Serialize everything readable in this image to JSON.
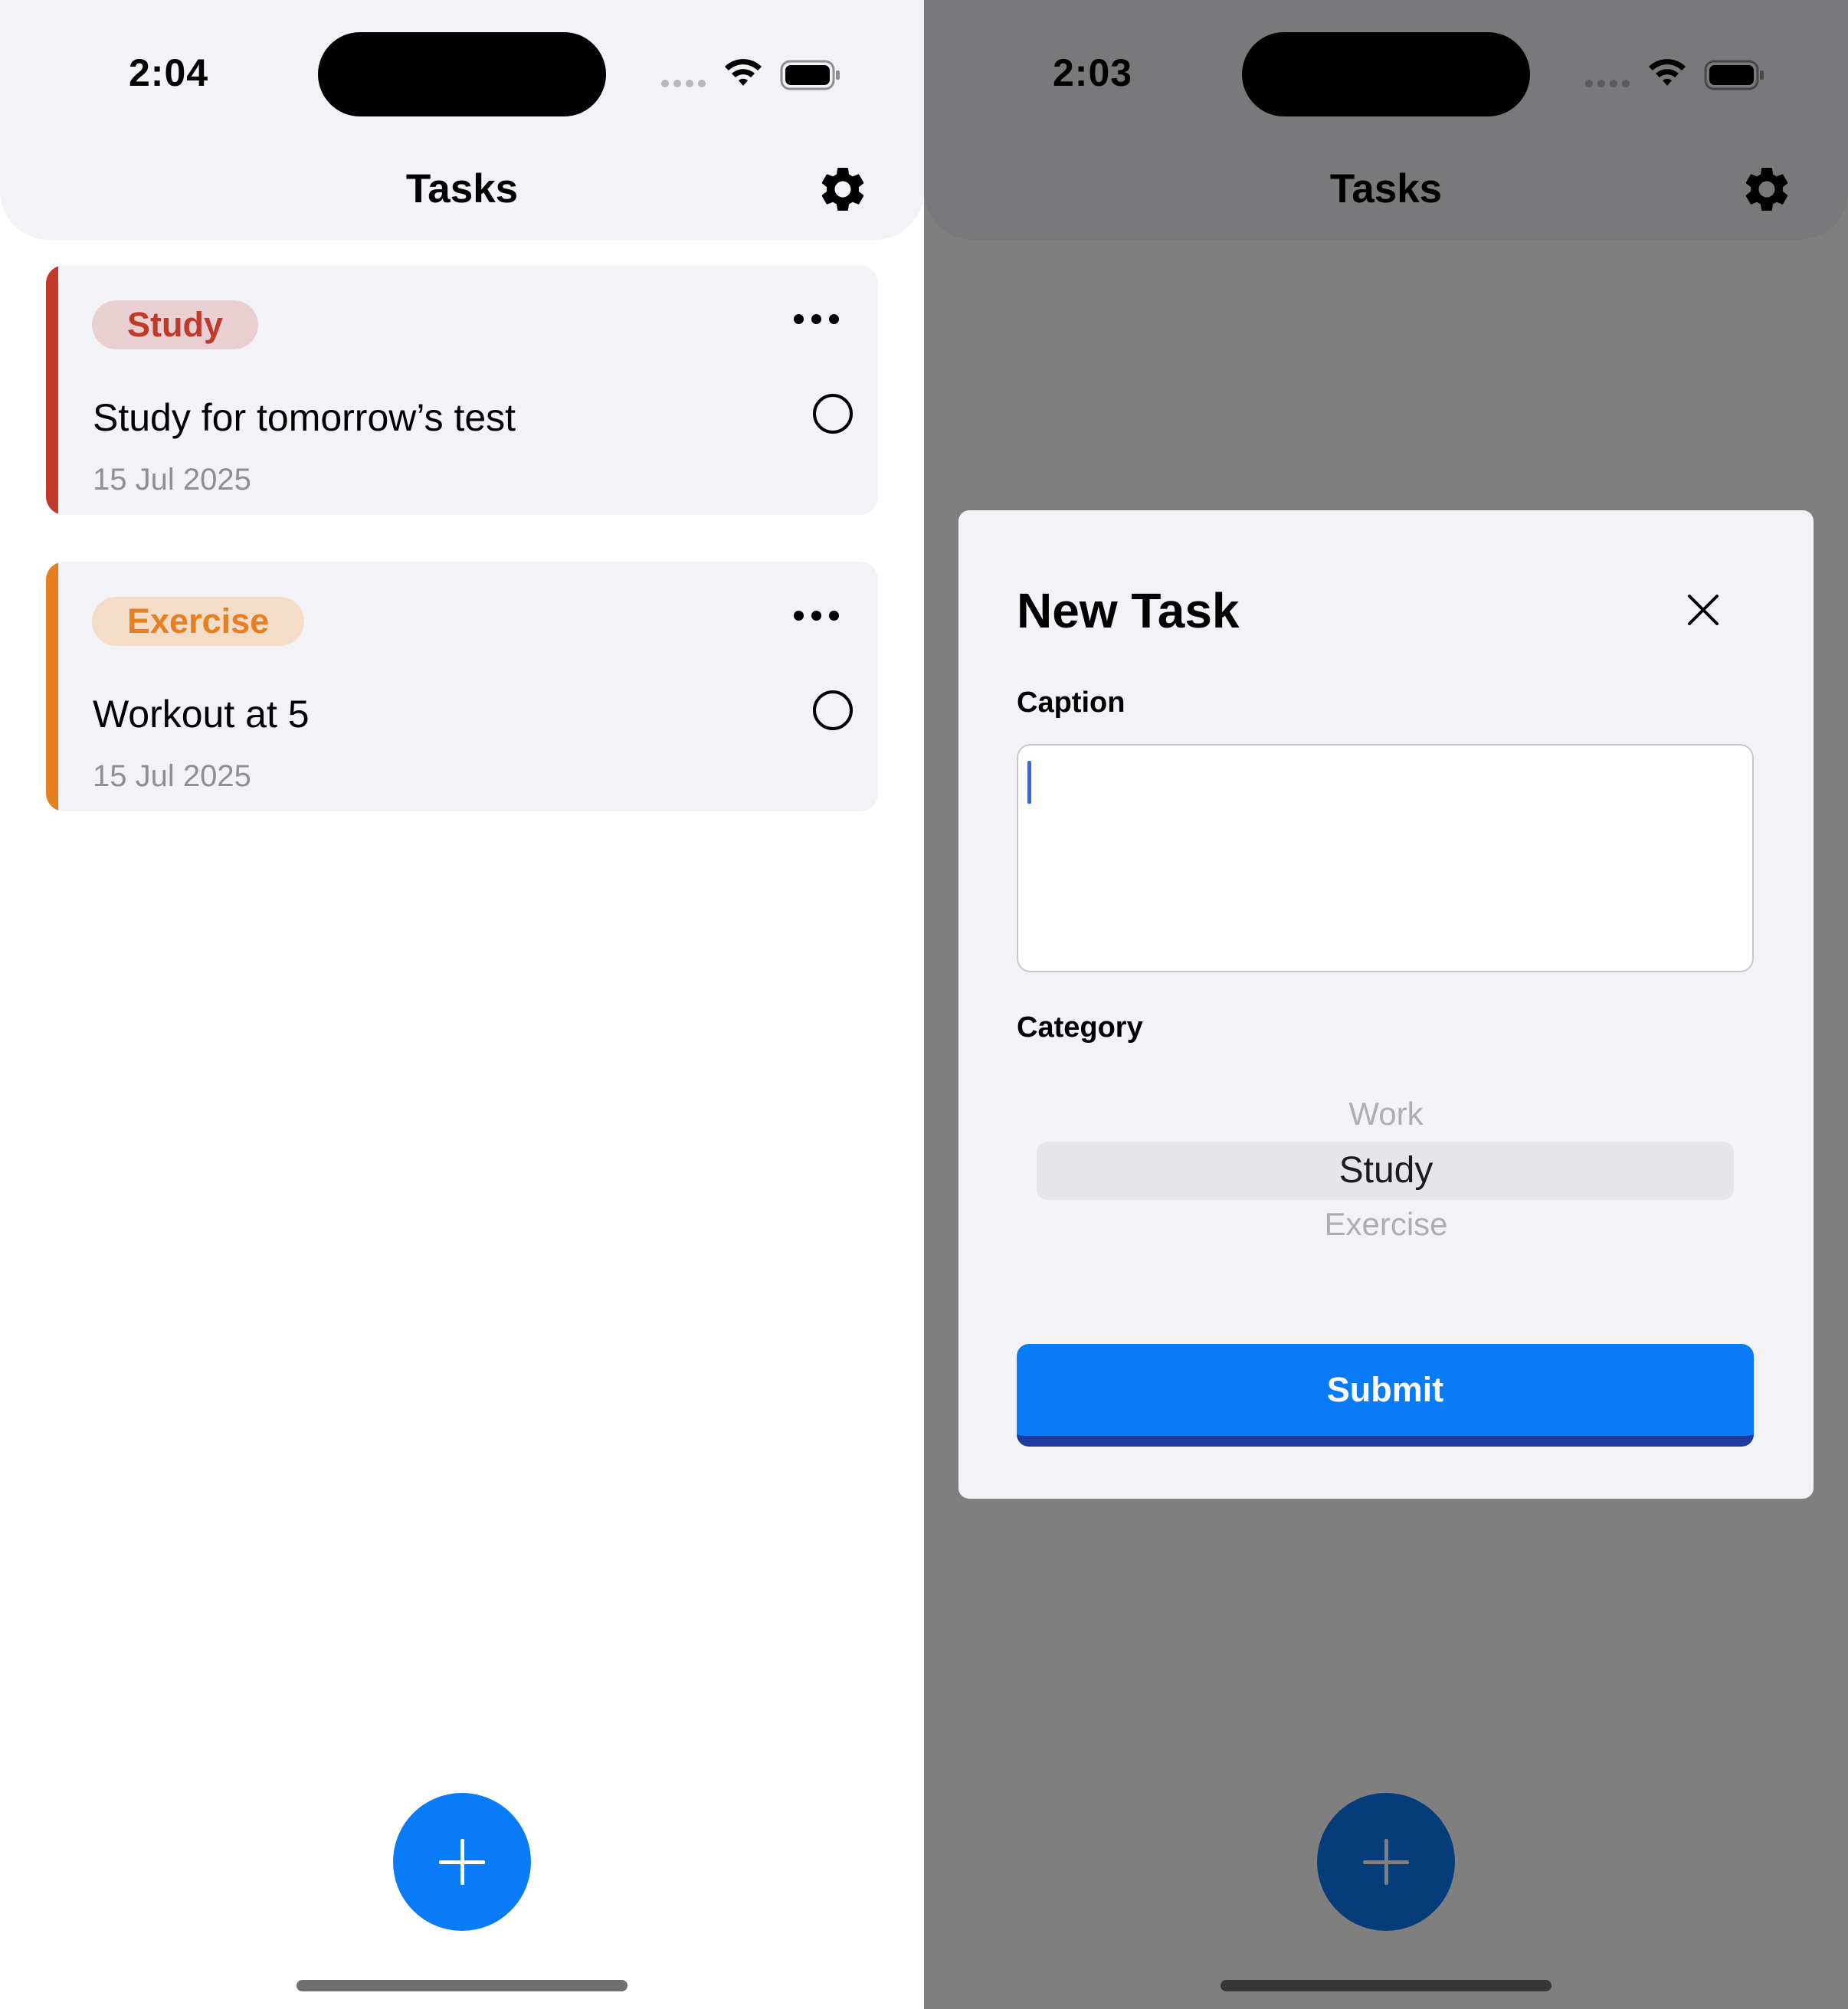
{
  "left": {
    "status_bar": {
      "time": "2:04"
    },
    "nav": {
      "title": "Tasks"
    },
    "tasks": [
      {
        "category": "Study",
        "title": "Study for tomorrow’s test",
        "date": "15 Jul 2025"
      },
      {
        "category": "Exercise",
        "title": "Workout at 5",
        "date": "15 Jul 2025"
      }
    ]
  },
  "right": {
    "status_bar": {
      "time": "2:03"
    },
    "nav": {
      "title": "Tasks"
    },
    "modal": {
      "title": "New Task",
      "caption_label": "Caption",
      "caption_value": "",
      "category_label": "Category",
      "category_options": [
        "Work",
        "Study",
        "Exercise"
      ],
      "selected_category": "Study",
      "submit_label": "Submit"
    }
  },
  "colors": {
    "accent": "#0a7bf7",
    "study": "#c0392b",
    "study_chip_bg": "#e9cfd2",
    "exercise": "#e67e22",
    "exercise_chip_bg": "#f4dcc6",
    "header_bg": "#f2f2f7"
  },
  "icons": [
    "settings-gear-icon",
    "more-horizontal-icon",
    "circle-check-icon",
    "plus-icon",
    "close-icon",
    "wifi-icon",
    "battery-icon"
  ]
}
